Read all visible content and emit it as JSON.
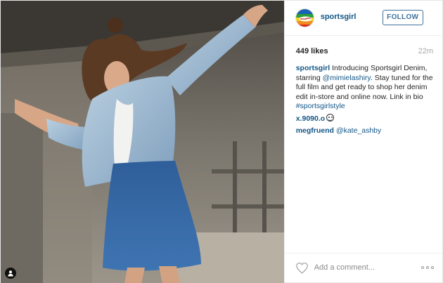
{
  "post": {
    "photo_alt": "",
    "header": {
      "username": "sportsgirl",
      "follow_label": "FOLLOW"
    },
    "likes": "449 likes",
    "time": "22m",
    "comments": [
      {
        "user": "sportsgirl",
        "segments": [
          {
            "type": "text",
            "text": " Introducing Sportsgirl Denim, starring "
          },
          {
            "type": "link",
            "text": "@mimielashiry"
          },
          {
            "type": "text",
            "text": ". Stay tuned for the full film and get ready to shop her denim edit in-store and online now. Link in bio "
          },
          {
            "type": "link",
            "text": "#sportsgirlstyle"
          }
        ]
      },
      {
        "user": "x.9090.o",
        "segments": [],
        "emoji": "smiley-icon"
      },
      {
        "user": "megfruend",
        "segments": [
          {
            "type": "text",
            "text": " "
          },
          {
            "type": "link",
            "text": "@kate_ashby"
          }
        ]
      }
    ],
    "add_comment_placeholder": "Add a comment...",
    "colors": {
      "link": "#125688",
      "follow": "#3f729b",
      "muted": "#a5a7aa"
    }
  }
}
